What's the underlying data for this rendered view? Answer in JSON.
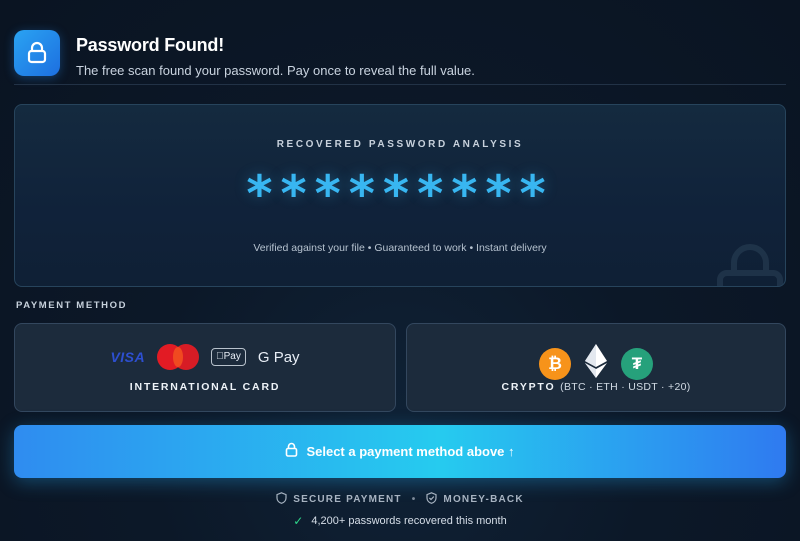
{
  "header": {
    "title": "Password Found!",
    "subtitle": "The free scan found your password. Pay once to reveal the full value.",
    "icon": "lock-icon",
    "icon_color": "#2aa3f2"
  },
  "analysis": {
    "label": "RECOVERED PASSWORD ANALYSIS",
    "masked_password": "*********",
    "verified_text": "Verified against your file • Guaranteed to work • Instant delivery",
    "accent_color": "#38b6f1"
  },
  "payment": {
    "section_label": "PAYMENT METHOD",
    "card_option": {
      "label": "INTERNATIONAL CARD",
      "logos": {
        "visa": "VISA",
        "apple_pay": "Pay",
        "google_pay": "G Pay"
      }
    },
    "crypto_option": {
      "label": "CRYPTO",
      "sub_label": "(BTC · ETH · USDT · +20)",
      "icons": [
        "bitcoin-icon",
        "ethereum-icon",
        "tether-icon"
      ]
    }
  },
  "cta": {
    "label": "Select a payment method above ↑",
    "gradient": [
      "#2f8cf0",
      "#26cbef"
    ]
  },
  "trust": {
    "secure": "SECURE PAYMENT",
    "separator": "•",
    "money_back": "MONEY-BACK",
    "recovered": "4,200+ passwords recovered this month",
    "check_color": "#2ed58a"
  }
}
